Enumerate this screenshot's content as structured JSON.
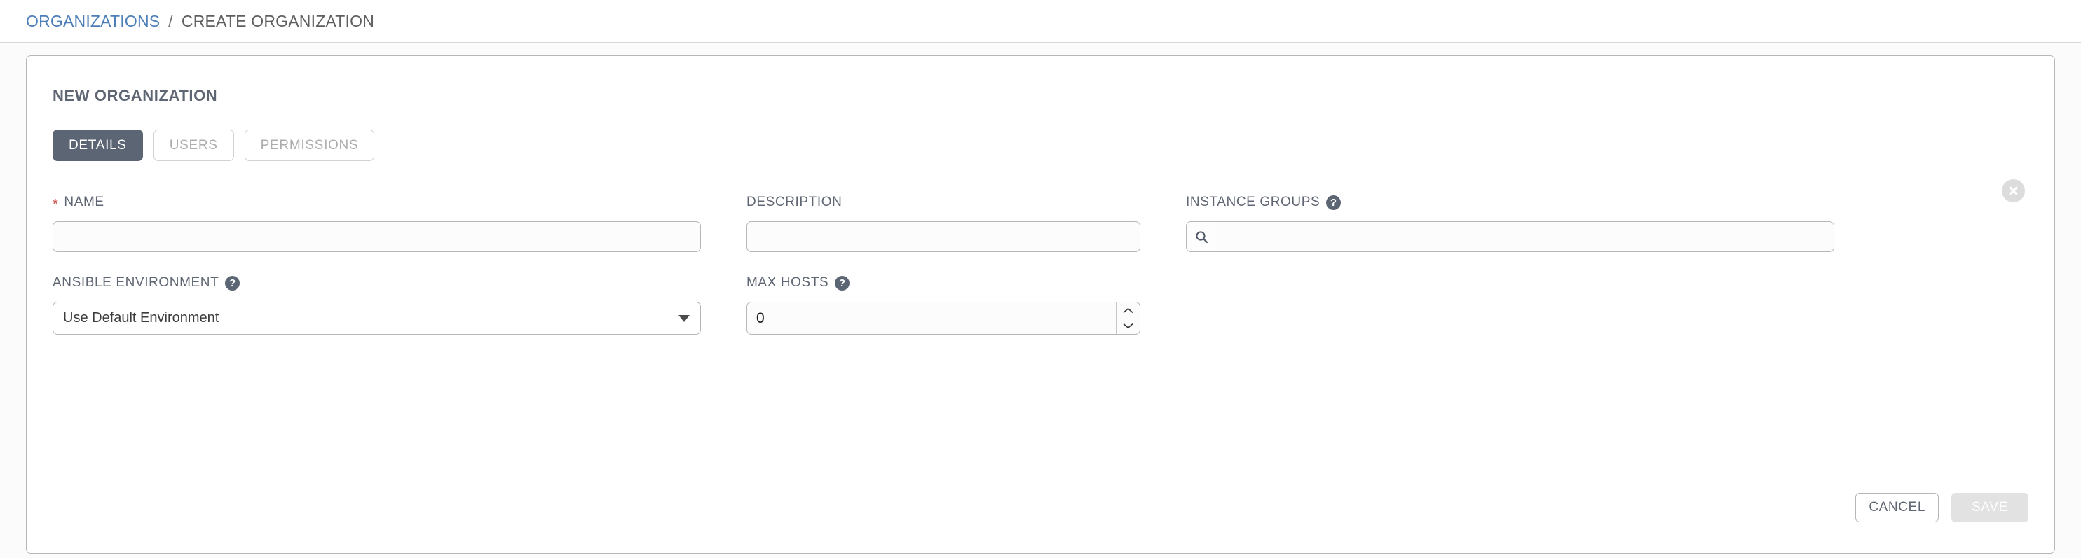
{
  "breadcrumb": {
    "parent": "ORGANIZATIONS",
    "separator": "/",
    "current": "CREATE ORGANIZATION"
  },
  "card": {
    "title": "NEW ORGANIZATION",
    "close_icon": "close-circle-icon"
  },
  "tabs": [
    {
      "label": "DETAILS",
      "state": "active"
    },
    {
      "label": "USERS",
      "state": "inactive"
    },
    {
      "label": "PERMISSIONS",
      "state": "inactive"
    }
  ],
  "form": {
    "name": {
      "label": "NAME",
      "required_marker": "*",
      "value": "",
      "placeholder": ""
    },
    "description": {
      "label": "DESCRIPTION",
      "value": "",
      "placeholder": ""
    },
    "instance_groups": {
      "label": "INSTANCE GROUPS",
      "help": "?",
      "search_icon": "search-icon",
      "value": "",
      "placeholder": ""
    },
    "ansible_environment": {
      "label": "ANSIBLE ENVIRONMENT",
      "help": "?",
      "selected": "Use Default Environment",
      "options": [
        "Use Default Environment"
      ]
    },
    "max_hosts": {
      "label": "MAX HOSTS",
      "help": "?",
      "value": "0",
      "increment_icon": "chevron-up-icon",
      "decrement_icon": "chevron-down-icon"
    }
  },
  "actions": {
    "cancel_label": "CANCEL",
    "save_label": "SAVE",
    "save_disabled": true
  },
  "colors": {
    "link": "#4d7eb8",
    "tab_active_bg": "#5c6573",
    "label": "#5f6673",
    "required_star": "#c9504b",
    "save_disabled_bg": "#e2e2e2",
    "border": "#b7b7b7",
    "page_bg": "#fbfbfb"
  }
}
